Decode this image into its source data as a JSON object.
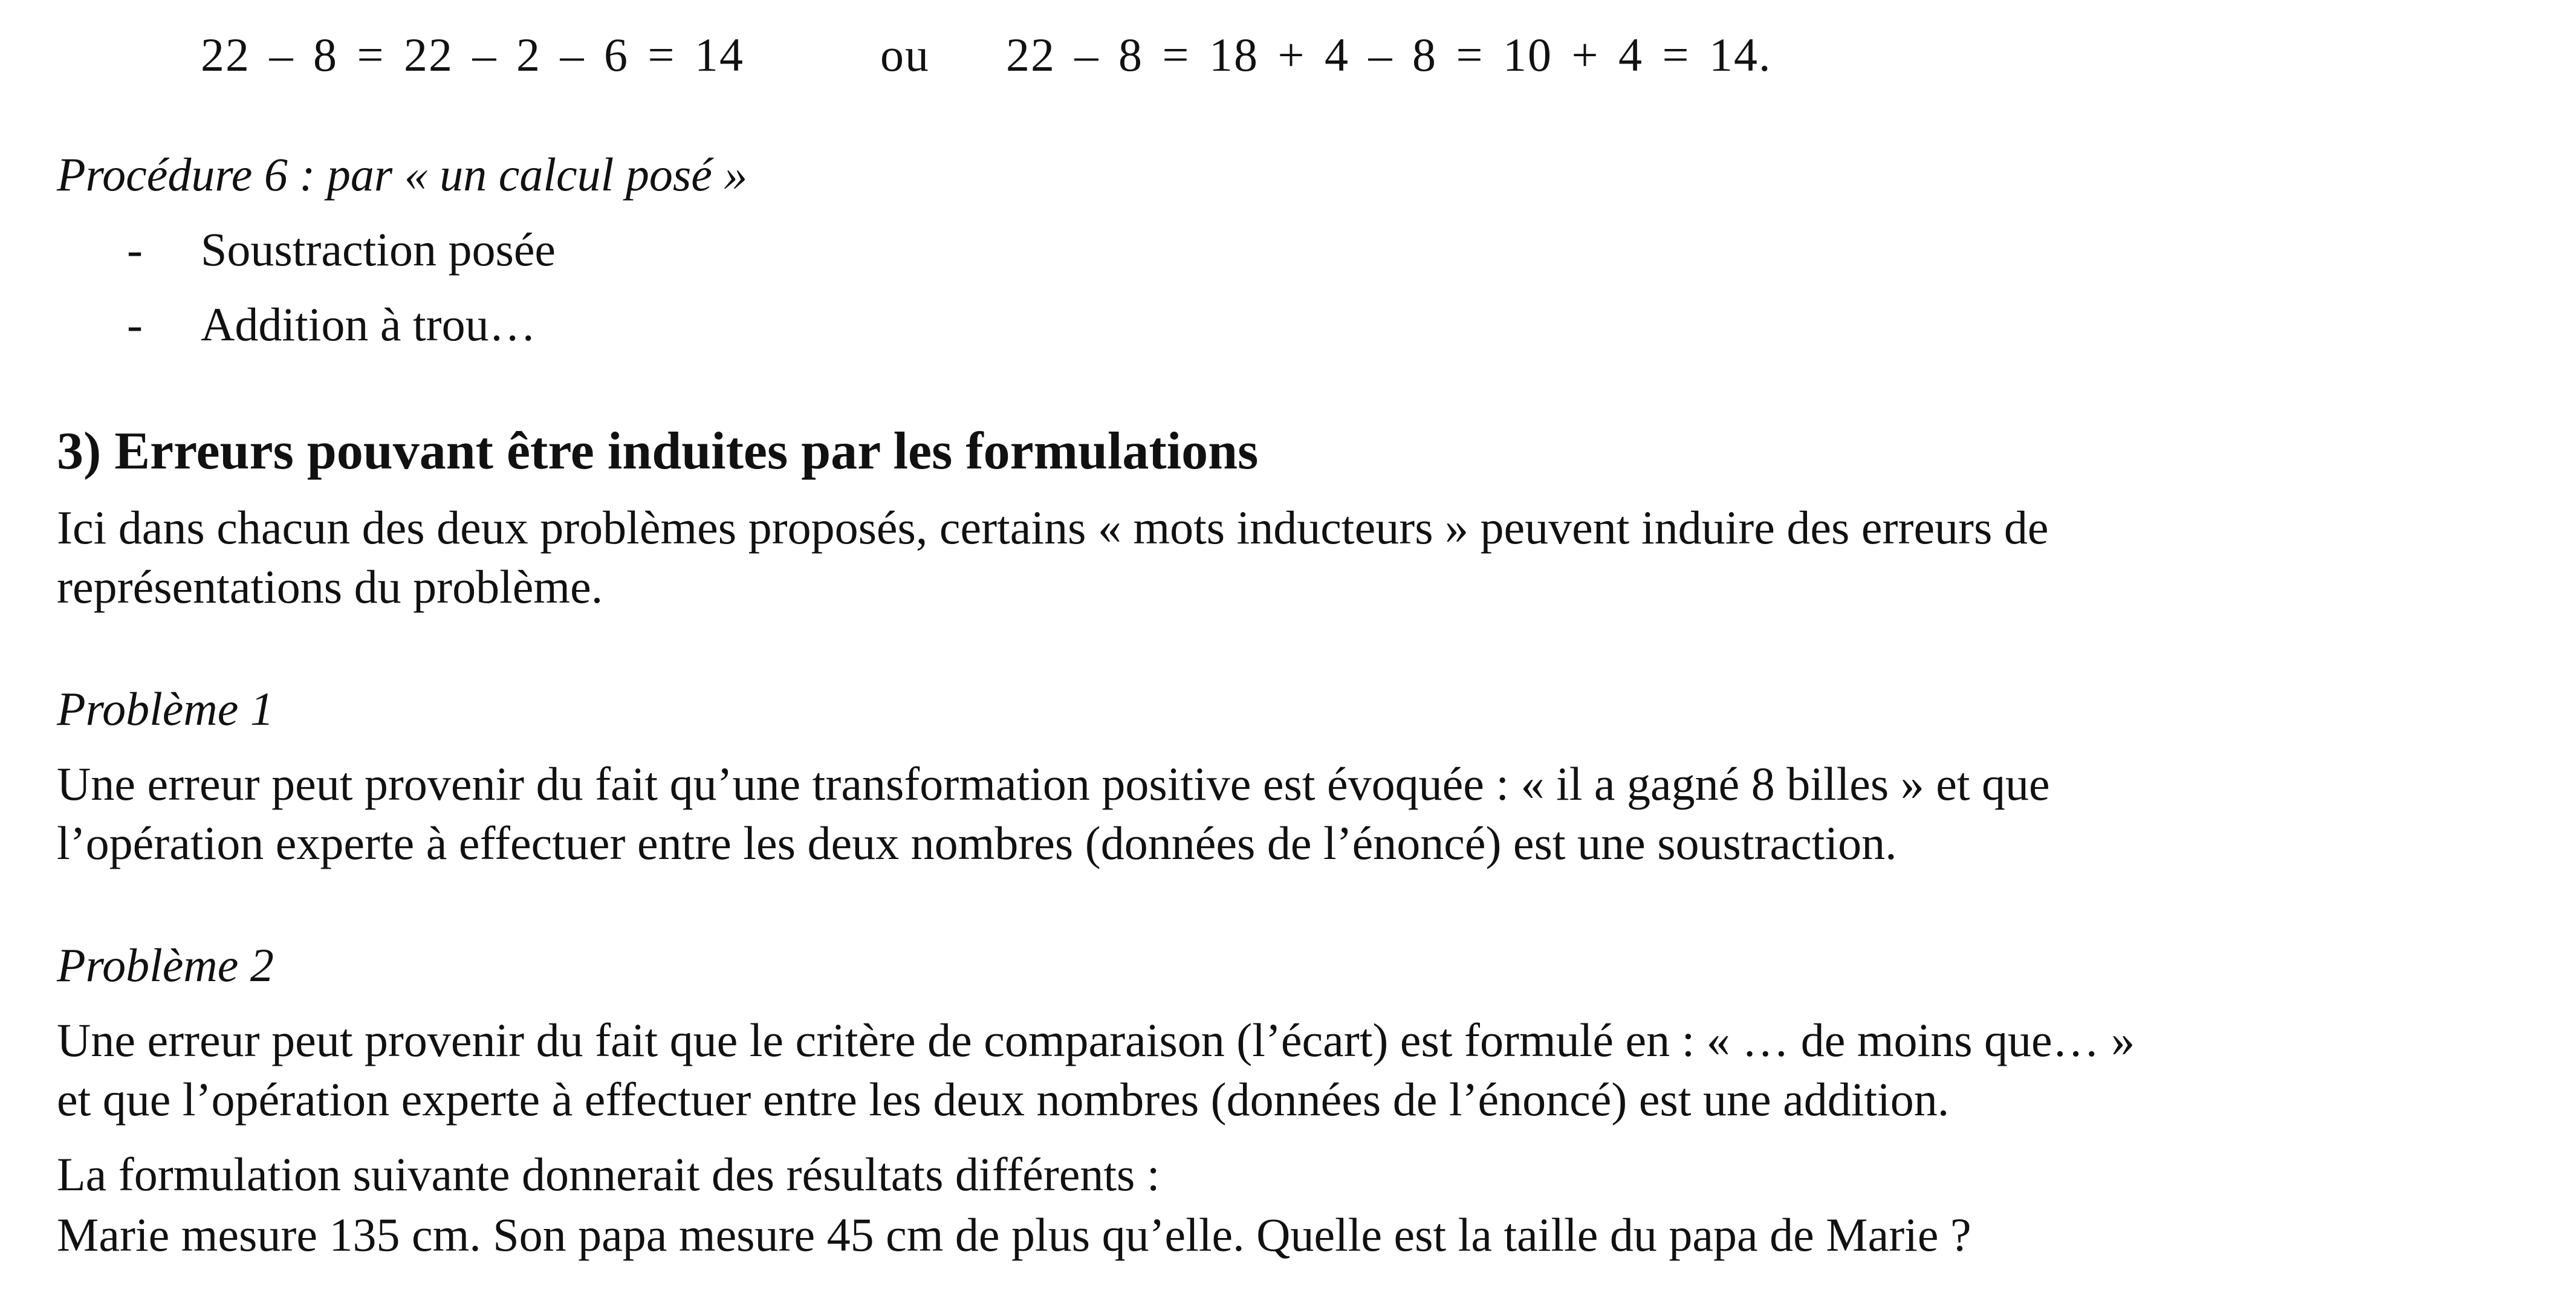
{
  "calculation": {
    "left": "22 – 8 = 22 – 2 – 6 = 14",
    "connector": "ou",
    "right": "22 – 8 = 18 + 4 – 8 = 10 + 4 = 14."
  },
  "procedure6": {
    "title": "Procédure 6 : par « un calcul posé »",
    "bullet_marker": "-",
    "items": [
      "Soustraction posée",
      "Addition à trou…"
    ]
  },
  "section3": {
    "number": "3)",
    "title": "Erreurs pouvant être induites par les formulations",
    "intro_lines": [
      "Ici dans chacun des deux problèmes proposés, certains « mots inducteurs » peuvent induire des erreurs de",
      "représentations du problème."
    ]
  },
  "probleme1": {
    "title": "Problème 1",
    "lines": [
      "Une erreur peut provenir du fait qu’une transformation positive est évoquée : « il a gagné 8 billes » et que",
      "l’opération experte à effectuer entre les deux nombres (données de l’énoncé) est une soustraction."
    ]
  },
  "probleme2": {
    "title": "Problème 2",
    "lines": [
      "Une erreur peut provenir du fait que le critère de comparaison (l’écart) est formulé en : « … de moins que… »",
      "et que l’opération experte à effectuer entre les deux nombres (données de l’énoncé) est une addition.",
      "La formulation suivante donnerait des résultats différents :",
      "Marie mesure 135 cm. Son papa mesure 45 cm de plus qu’elle. Quelle est la taille du papa de Marie ?"
    ]
  }
}
